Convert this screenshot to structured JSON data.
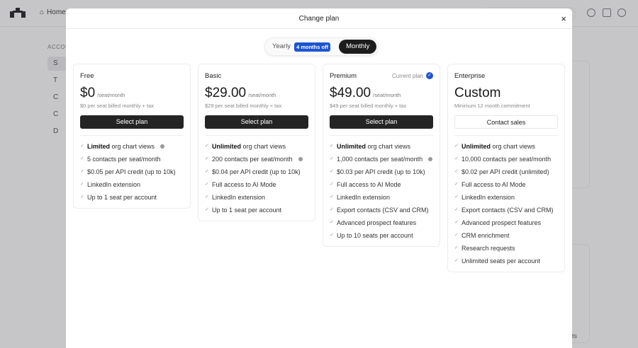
{
  "background": {
    "home": "Home",
    "section": "ACCOU",
    "sidebar": [
      "S",
      "T",
      "C",
      "C",
      "D"
    ],
    "corner_text": "ts"
  },
  "modal": {
    "title": "Change plan",
    "close": "×",
    "toggle": {
      "yearly": "Yearly",
      "badge": "4 months off",
      "monthly": "Monthly",
      "selected": "Monthly"
    },
    "plans": [
      {
        "name": "Free",
        "price": "$0",
        "per": "/seat/month",
        "sub": "$0 per seat billed monthly + tax",
        "button": "Select plan",
        "features": [
          {
            "bold": "Limited",
            "text": " org chart views",
            "info": true
          },
          {
            "bold": "",
            "text": "5 contacts per seat/month"
          },
          {
            "bold": "",
            "text": "$0.05 per API credit (up to 10k)"
          },
          {
            "bold": "",
            "text": "LinkedIn extension"
          },
          {
            "bold": "",
            "text": "Up to 1 seat per account"
          }
        ]
      },
      {
        "name": "Basic",
        "price": "$29.00",
        "per": "/seat/month",
        "sub": "$29 per seat billed monthly + tax",
        "button": "Select plan",
        "features": [
          {
            "bold": "Unlimited",
            "text": " org chart views"
          },
          {
            "bold": "",
            "text": "200 contacts per seat/month",
            "info": true
          },
          {
            "bold": "",
            "text": "$0.04 per API credit (up to 10k)"
          },
          {
            "bold": "",
            "text": "Full access to AI Mode"
          },
          {
            "bold": "",
            "text": "LinkedIn extension"
          },
          {
            "bold": "",
            "text": "Up to 1 seat per account"
          }
        ]
      },
      {
        "name": "Premium",
        "current": "Current plan",
        "price": "$49.00",
        "per": "/seat/month",
        "sub": "$49 per seat billed monthly + tax",
        "button": "Select plan",
        "features": [
          {
            "bold": "Unlimited",
            "text": " org chart views"
          },
          {
            "bold": "",
            "text": "1,000 contacts per seat/month",
            "info": true
          },
          {
            "bold": "",
            "text": "$0.03 per API credit (up to 10k)"
          },
          {
            "bold": "",
            "text": "Full access to AI Mode"
          },
          {
            "bold": "",
            "text": "LinkedIn extension"
          },
          {
            "bold": "",
            "text": "Export contacts (CSV and CRM)"
          },
          {
            "bold": "",
            "text": "Advanced prospect features"
          },
          {
            "bold": "",
            "text": "Up to 10 seats per account"
          }
        ]
      },
      {
        "name": "Enterprise",
        "price": "Custom",
        "per": "",
        "sub": "Minimum 12 month commitment",
        "button": "Contact sales",
        "light": true,
        "features": [
          {
            "bold": "Unlimited",
            "text": " org chart views"
          },
          {
            "bold": "",
            "text": "10,000 contacts per seat/month"
          },
          {
            "bold": "",
            "text": "$0.02 per API credit (unlimited)"
          },
          {
            "bold": "",
            "text": "Full access to AI Mode"
          },
          {
            "bold": "",
            "text": "LinkedIn extension"
          },
          {
            "bold": "",
            "text": "Export contacts (CSV and CRM)"
          },
          {
            "bold": "",
            "text": "Advanced prospect features"
          },
          {
            "bold": "",
            "text": "CRM enrichment"
          },
          {
            "bold": "",
            "text": "Research requests"
          },
          {
            "bold": "",
            "text": "Unlimited seats per account"
          }
        ]
      }
    ]
  }
}
